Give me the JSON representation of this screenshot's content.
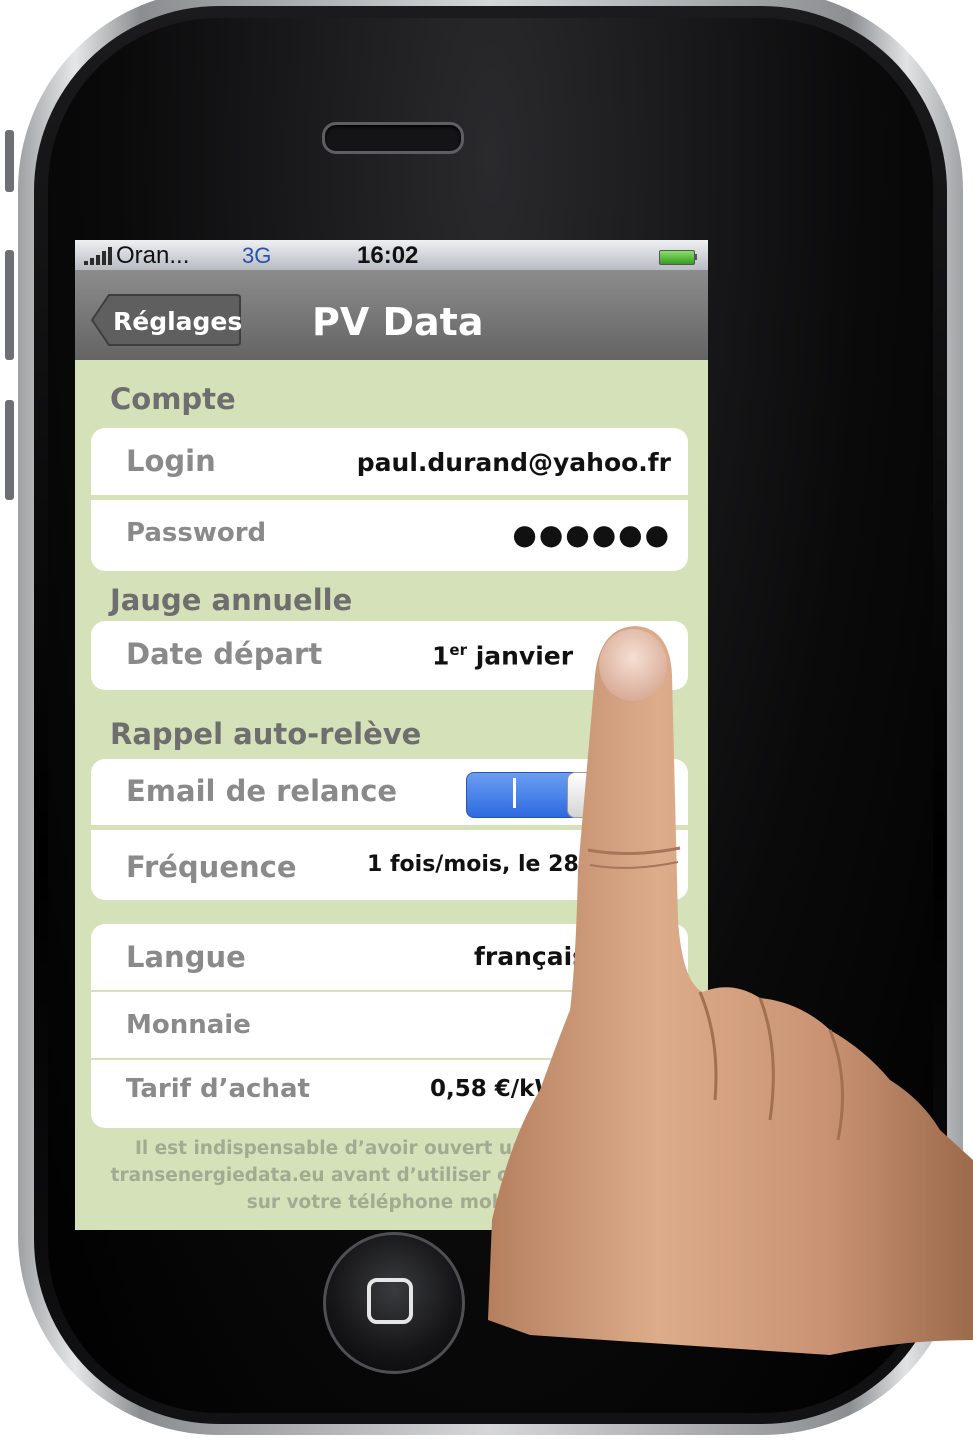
{
  "status": {
    "carrier": "Oran...",
    "network": "3G",
    "time": "16:02"
  },
  "nav": {
    "back_label": "Réglages",
    "title": "PV Data"
  },
  "sections": {
    "account": {
      "header": "Compte",
      "login_label": "Login",
      "login_value": "paul.durand@yahoo.fr",
      "password_label": "Password",
      "password_value": "●●●●●●"
    },
    "gauge": {
      "header": "Jauge annuelle",
      "date_label": "Date départ",
      "date_value_num": "1",
      "date_value_sup": "er",
      "date_value_text": " janvier"
    },
    "reminder": {
      "header": "Rappel auto-relève",
      "email_label": "Email de relance",
      "email_toggle_on": true,
      "freq_label": "Fréquence",
      "freq_value": "1 fois/mois, le 28"
    },
    "prefs": {
      "lang_label": "Langue",
      "lang_value": "français",
      "currency_label": "Monnaie",
      "tariff_label": "Tarif d’achat",
      "tariff_value": "0,58 €/kWh"
    }
  },
  "footer": {
    "line1": "Il est indispensable d’avoir ouvert un compte sur",
    "line2": "transenergiedata.eu avant d’utiliser cette application",
    "line3": "sur votre téléphone mobile."
  },
  "colors": {
    "screen_bg": "#d4e1b9",
    "nav_bar": "#737373",
    "toggle_on": "#3b78e7"
  }
}
